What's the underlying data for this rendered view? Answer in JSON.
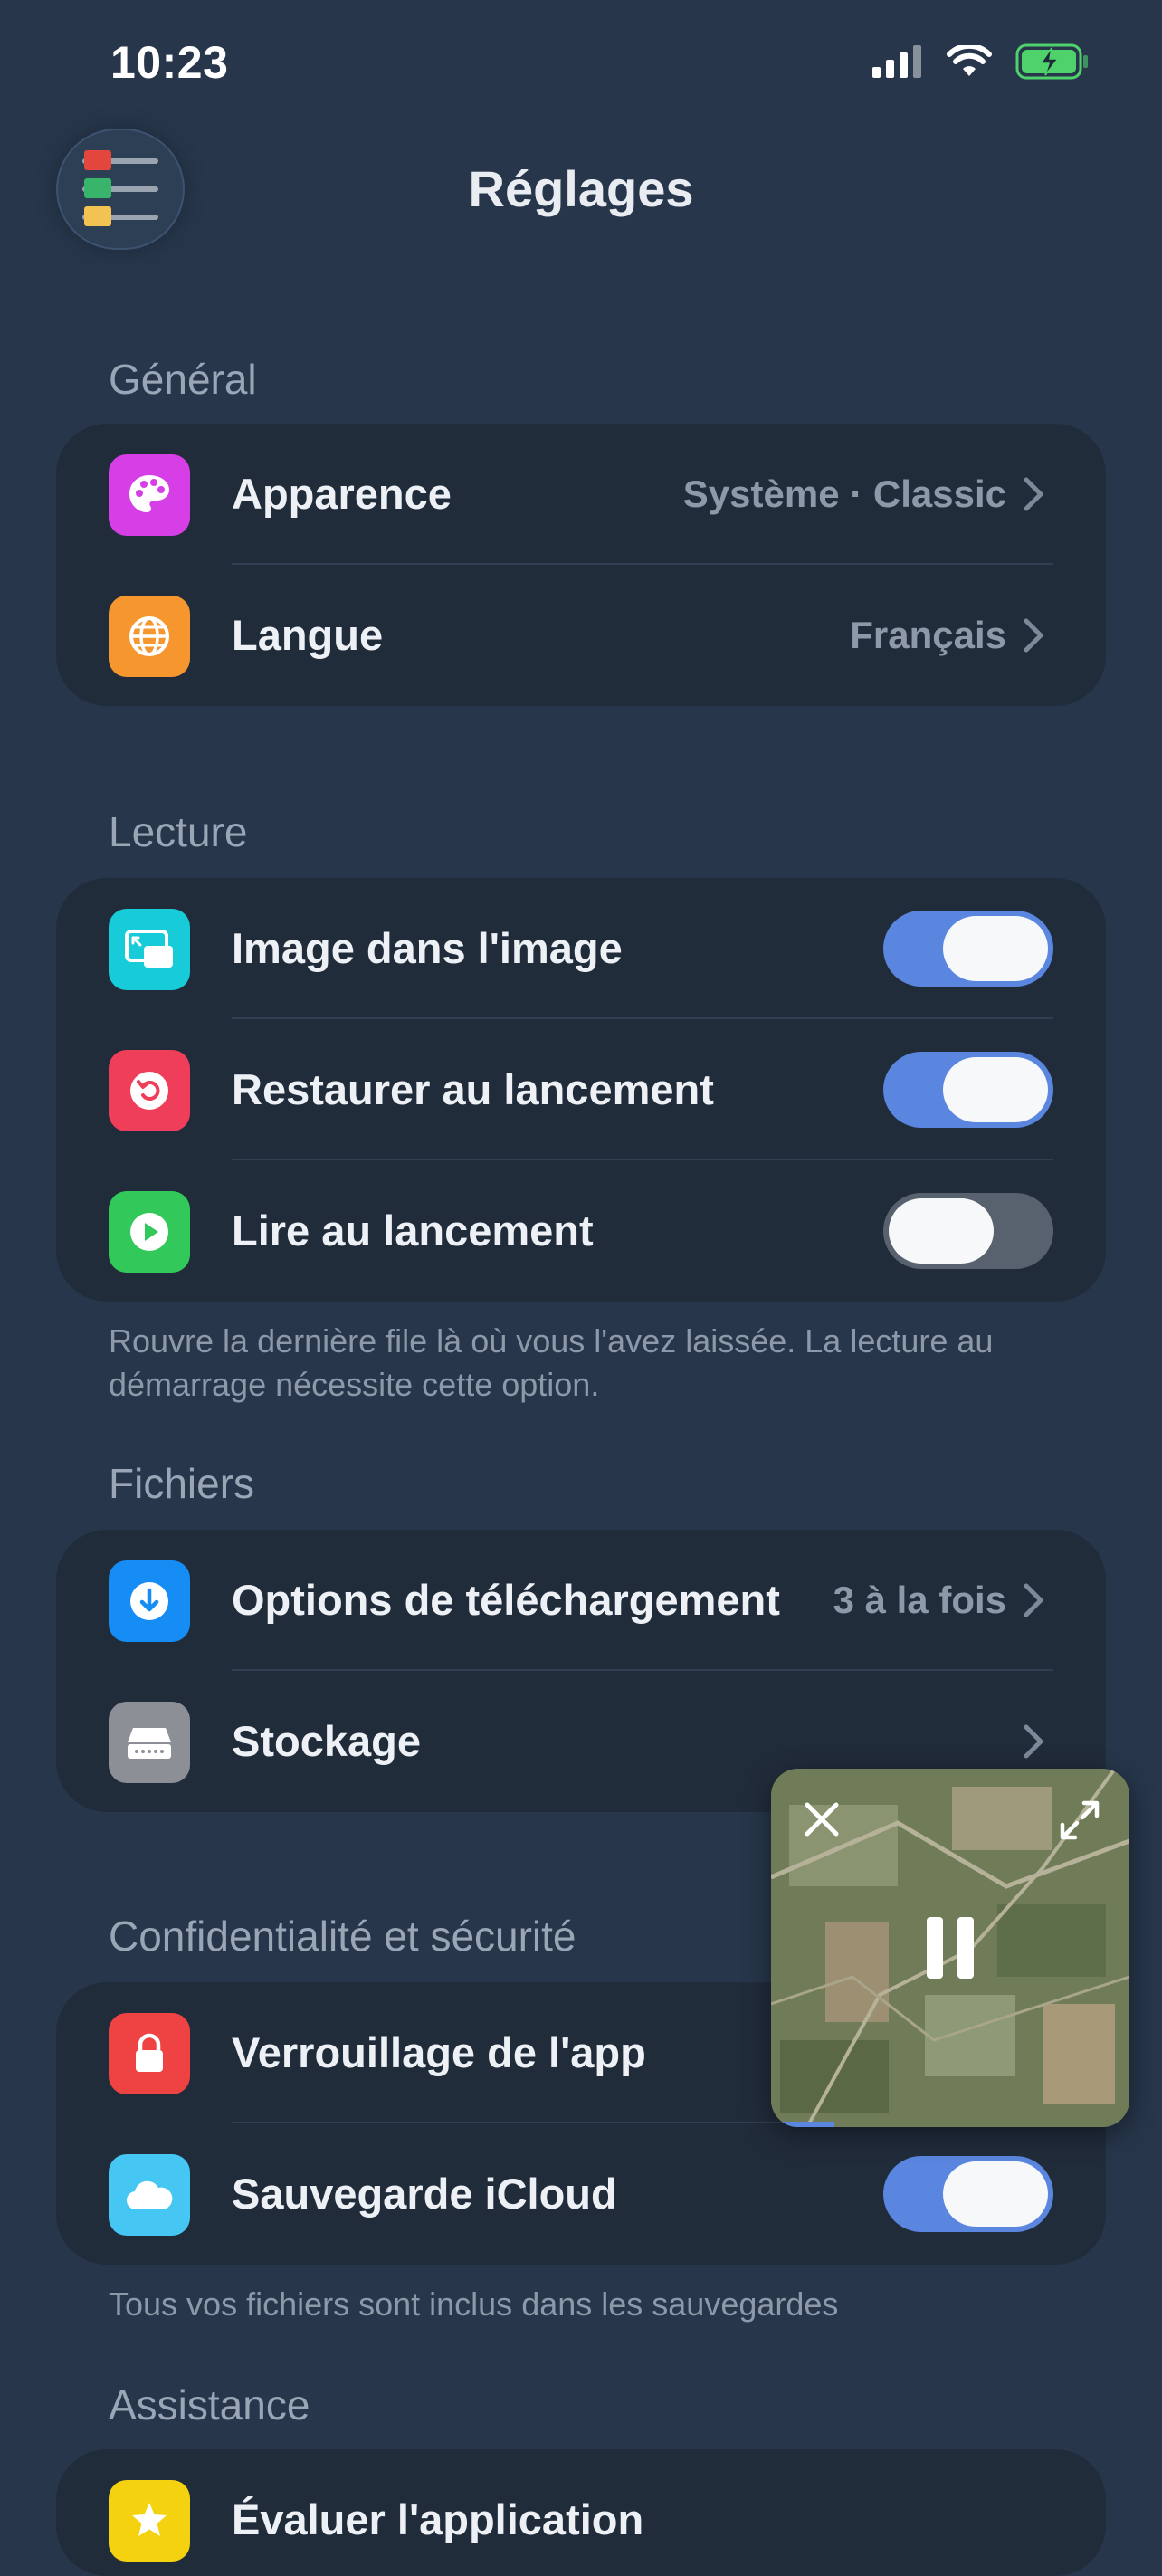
{
  "status_bar": {
    "time": "10:23"
  },
  "header": {
    "title": "Réglages"
  },
  "sections": {
    "general": {
      "title": "Général",
      "appearance": {
        "label": "Apparence",
        "value": "Système · Classic"
      },
      "language": {
        "label": "Langue",
        "value": "Français"
      }
    },
    "playback": {
      "title": "Lecture",
      "pip": {
        "label": "Image dans l'image",
        "on": true
      },
      "restore": {
        "label": "Restaurer au lancement",
        "on": true
      },
      "autoplay": {
        "label": "Lire au lancement",
        "on": false
      },
      "footnote": "Rouvre la dernière file là où vous l'avez laissée. La lecture au démarrage nécessite cette option."
    },
    "files": {
      "title": "Fichiers",
      "downloads": {
        "label": "Options de téléchargement",
        "value": "3 à la fois"
      },
      "storage": {
        "label": "Stockage"
      }
    },
    "privacy": {
      "title": "Confidentialité et sécurité",
      "app_lock": {
        "label": "Verrouillage de l'app"
      },
      "icloud": {
        "label": "Sauvegarde iCloud",
        "on": true
      },
      "footnote": "Tous vos fichiers sont inclus dans les sauvegardes"
    },
    "support": {
      "title": "Assistance",
      "rate": {
        "label": "Évaluer l'application"
      }
    }
  },
  "colors": {
    "background": "#27364b",
    "card": "#212c3b",
    "toggle_on": "#5a86e0",
    "appearance_icon": "#d63ee6",
    "language_icon": "#f5962f",
    "pip_icon": "#18cbd8",
    "restore_icon": "#ef3e5a",
    "autoplay_icon": "#32c85a",
    "downloads_icon": "#168cf5",
    "storage_icon": "#8c8f96",
    "lock_icon": "#ef4343",
    "icloud_icon": "#46c6f2",
    "rate_icon": "#f5d20f"
  },
  "icons": [
    "signal-icon",
    "wifi-icon",
    "battery-charging-icon",
    "menu-icon",
    "palette-icon",
    "globe-icon",
    "pip-icon",
    "restore-icon",
    "play-icon",
    "download-icon",
    "storage-icon",
    "lock-icon",
    "cloud-icon",
    "star-icon",
    "chevron-right-icon",
    "close-icon",
    "expand-icon",
    "pause-icon"
  ]
}
